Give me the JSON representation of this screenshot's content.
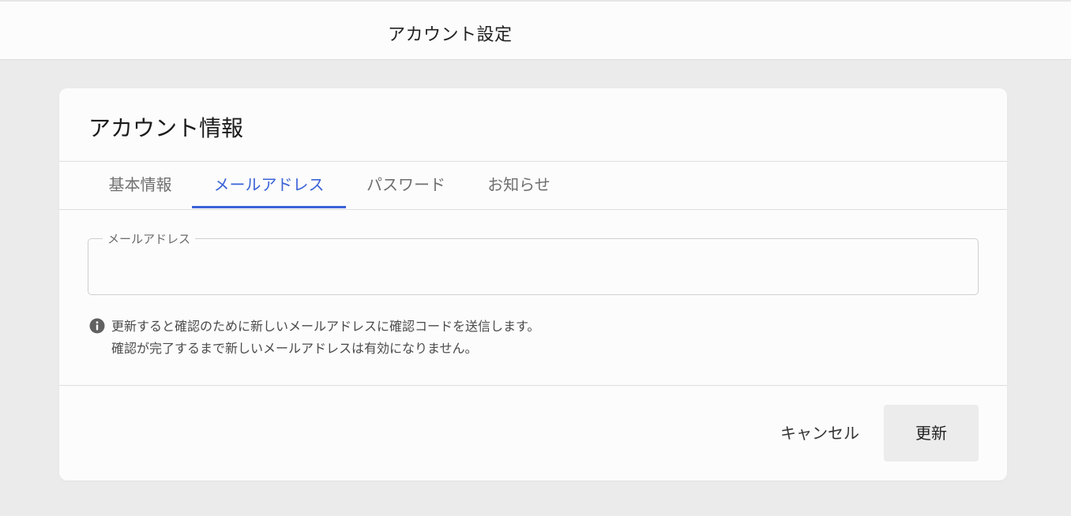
{
  "header": {
    "title": "アカウント設定"
  },
  "card": {
    "title": "アカウント情報",
    "tabs": [
      {
        "label": "基本情報",
        "active": false
      },
      {
        "label": "メールアドレス",
        "active": true
      },
      {
        "label": "パスワード",
        "active": false
      },
      {
        "label": "お知らせ",
        "active": false
      }
    ],
    "email_field": {
      "label": "メールアドレス",
      "value": ""
    },
    "info": {
      "icon": "info-icon",
      "lines": [
        "更新すると確認のために新しいメールアドレスに確認コードを送信します。",
        "確認が完了するまで新しいメールアドレスは有効になりません。"
      ]
    },
    "actions": {
      "cancel_label": "キャンセル",
      "update_label": "更新"
    }
  },
  "colors": {
    "accent": "#3a63d8",
    "background": "#ebebeb",
    "card": "#fcfcfc"
  }
}
